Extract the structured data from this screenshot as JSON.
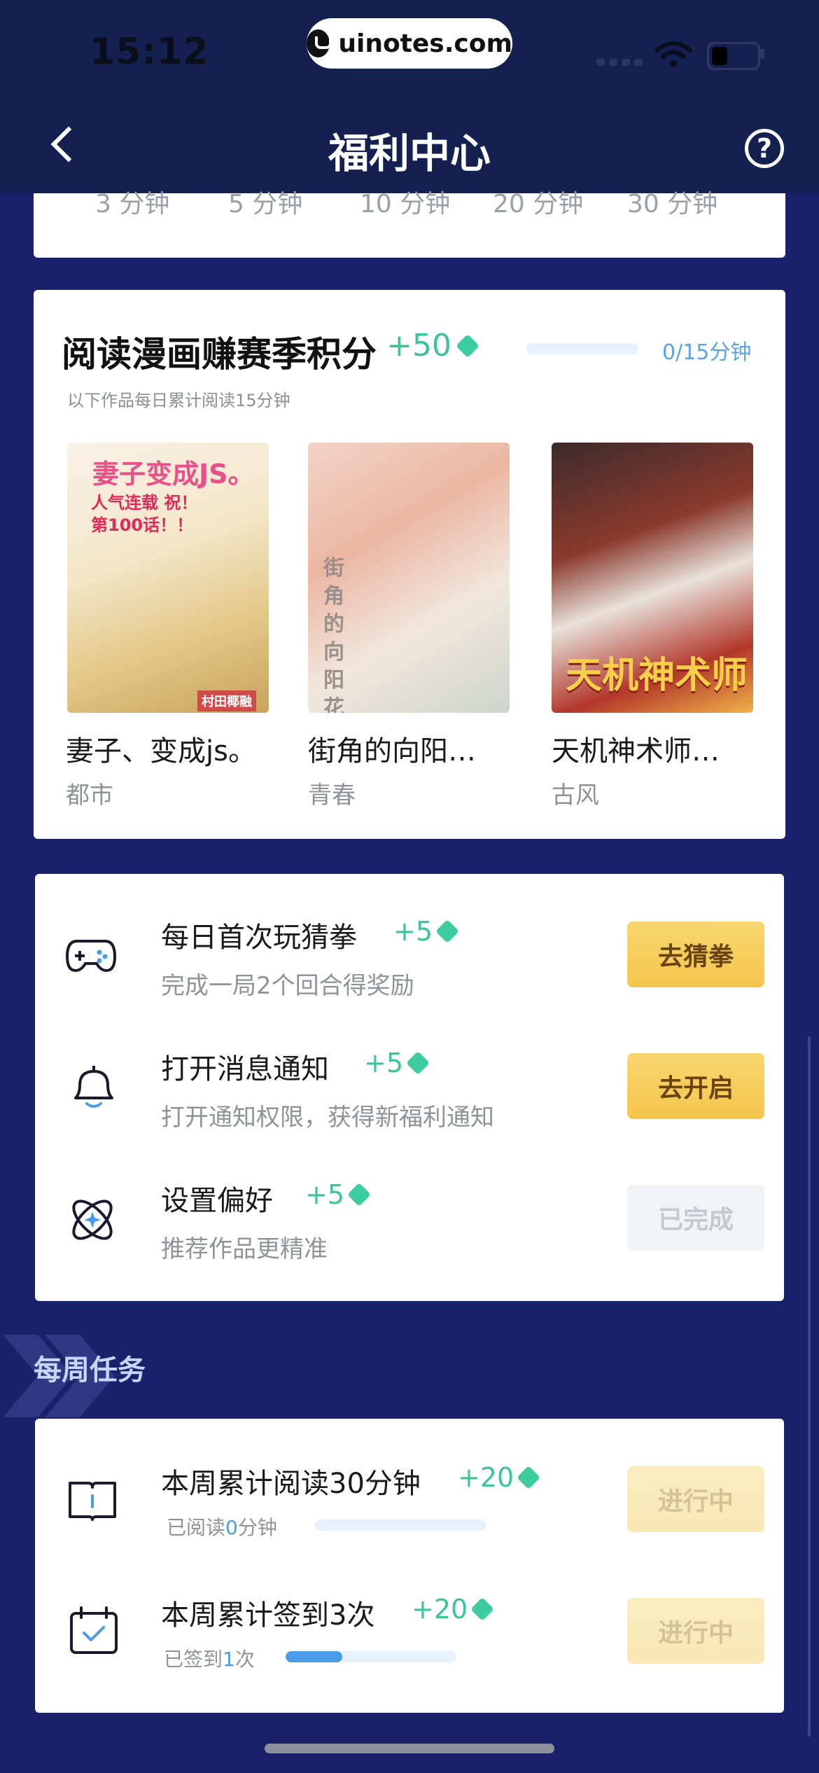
{
  "status": {
    "time": "15:12",
    "url_pill": "uinotes.com"
  },
  "nav": {
    "title": "福利中心",
    "help": "?"
  },
  "durations": [
    "3 分钟",
    "5 分钟",
    "10 分钟",
    "20 分钟",
    "30 分钟"
  ],
  "comic_section": {
    "title": "阅读漫画赚赛季积分",
    "reward": "+50",
    "progress_text": "0/15分钟",
    "progress_fraction": 0,
    "subtitle": "以下作品每日累计阅读15分钟",
    "books": [
      {
        "name": "妻子、变成js。",
        "genre": "都市",
        "cover_text": "妻子变成JS。",
        "cover_badge": "人气连载 祝！第100话！！",
        "cover_author": "村田椰融"
      },
      {
        "name": "街角的向阳…",
        "genre": "青春",
        "cover_text": "街角的向阳花屋"
      },
      {
        "name": "天机神术师…",
        "genre": "古风",
        "cover_text": "天机神术师"
      }
    ]
  },
  "daily_tasks": [
    {
      "title": "每日首次玩猜拳",
      "reward": "+5",
      "desc": "完成一局2个回合得奖励",
      "button": "去猜拳",
      "state": "go",
      "icon": "gamepad-icon"
    },
    {
      "title": "打开消息通知",
      "reward": "+5",
      "desc": "打开通知权限，获得新福利通知",
      "button": "去开启",
      "state": "go",
      "icon": "bell-icon"
    },
    {
      "title": "设置偏好",
      "reward": "+5",
      "desc": "推荐作品更精准",
      "button": "已完成",
      "state": "done",
      "icon": "orbit-icon"
    }
  ],
  "weekly": {
    "header": "每周任务",
    "tasks": [
      {
        "title": "本周累计阅读30分钟",
        "reward": "+20",
        "progress_prefix": "已阅读",
        "progress_value": "0",
        "progress_suffix": "分钟",
        "progress_fraction": 0,
        "button": "进行中",
        "icon": "book-icon"
      },
      {
        "title": "本周累计签到3次",
        "reward": "+20",
        "progress_prefix": "已签到",
        "progress_value": "1",
        "progress_suffix": "次",
        "progress_fraction": 0.33,
        "button": "进行中",
        "icon": "calendar-check-icon"
      }
    ]
  },
  "colors": {
    "background": "#19216b",
    "accent_green": "#39c49a",
    "accent_blue": "#4b9ce8",
    "button_gold": "#f3c54c"
  }
}
